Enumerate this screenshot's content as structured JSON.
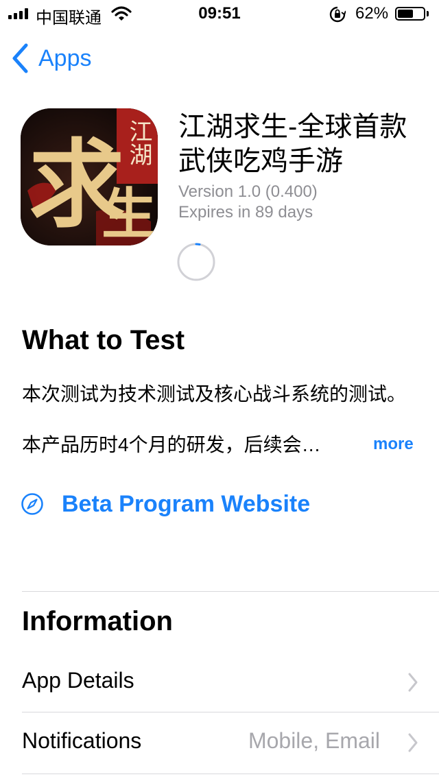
{
  "status_bar": {
    "carrier": "中国联通",
    "time": "09:51",
    "battery_percent": "62%",
    "battery_level": 0.62
  },
  "nav": {
    "back_label": "Apps"
  },
  "app": {
    "title": "江湖求生-全球首款武侠吃鸡手游",
    "version": "Version 1.0 (0.400)",
    "expires": "Expires in 89 days",
    "icon_text_main": "求生",
    "icon_text_side": "江湖"
  },
  "what_to_test": {
    "title": "What to Test",
    "body": "本次测试为技术测试及核心战斗系统的测试。",
    "line3": "本产品历时4个月的研发，后续会…",
    "more_label": "more"
  },
  "beta_link": {
    "label": "Beta Program Website"
  },
  "information": {
    "title": "Information",
    "rows": [
      {
        "label": "App Details",
        "value": ""
      },
      {
        "label": "Notifications",
        "value": "Mobile, Email"
      }
    ]
  },
  "colors": {
    "accent": "#1a82fb",
    "secondary_text": "#8e8e93",
    "divider": "#d8d8dc"
  },
  "icons": [
    "signal-icon",
    "wifi-icon",
    "rotation-lock-icon",
    "battery-icon",
    "back-chevron-icon",
    "loading-spinner-icon",
    "compass-icon",
    "chevron-right-icon"
  ]
}
